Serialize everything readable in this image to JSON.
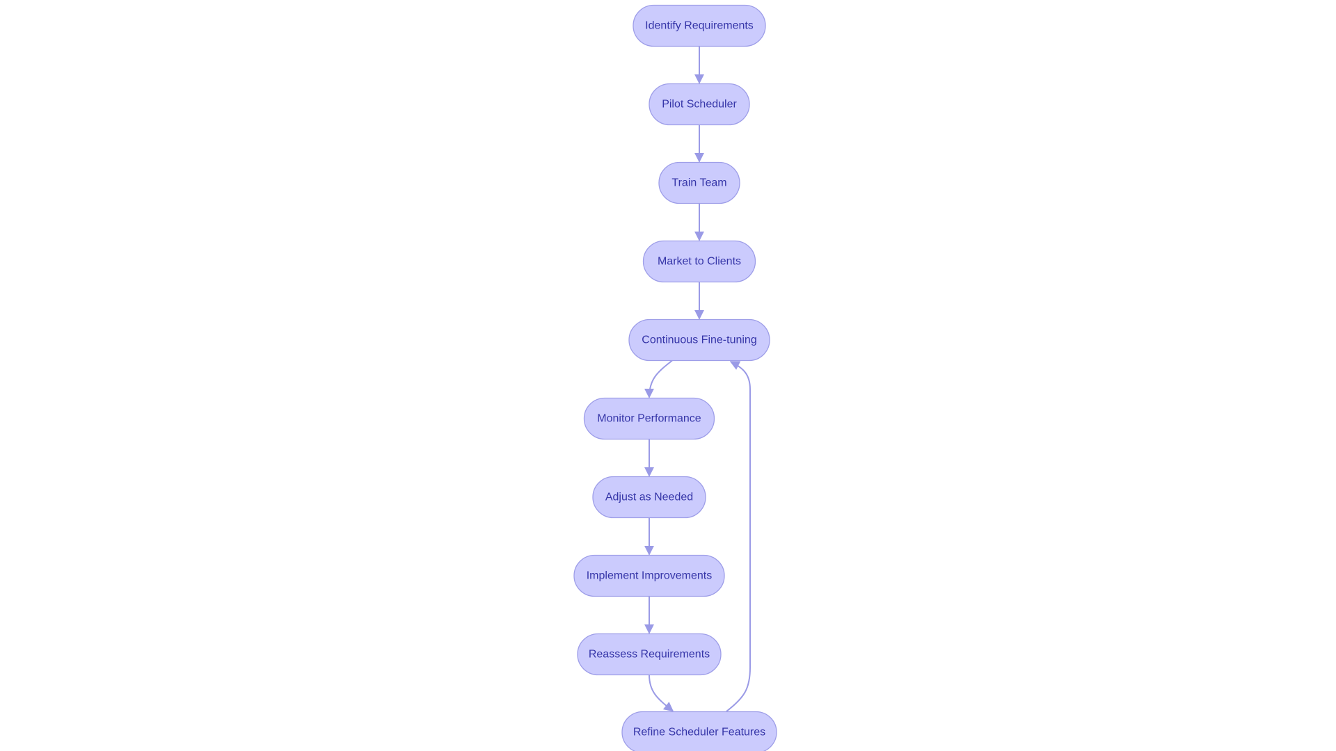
{
  "colors": {
    "node_fill": "#cbcbfd",
    "node_stroke": "#9e9ee8",
    "text": "#3535a8",
    "edge": "#9a9ae6"
  },
  "nodes": [
    {
      "id": "identify",
      "label": "Identify Requirements"
    },
    {
      "id": "pilot",
      "label": "Pilot Scheduler"
    },
    {
      "id": "train",
      "label": "Train Team"
    },
    {
      "id": "market",
      "label": "Market to Clients"
    },
    {
      "id": "finetune",
      "label": "Continuous Fine-tuning"
    },
    {
      "id": "monitor",
      "label": "Monitor Performance"
    },
    {
      "id": "adjust",
      "label": "Adjust as Needed"
    },
    {
      "id": "implement",
      "label": "Implement Improvements"
    },
    {
      "id": "reassess",
      "label": "Reassess Requirements"
    },
    {
      "id": "refine",
      "label": "Refine Scheduler Features"
    }
  ],
  "edges": [
    {
      "from": "identify",
      "to": "pilot"
    },
    {
      "from": "pilot",
      "to": "train"
    },
    {
      "from": "train",
      "to": "market"
    },
    {
      "from": "market",
      "to": "finetune"
    },
    {
      "from": "finetune",
      "to": "monitor"
    },
    {
      "from": "monitor",
      "to": "adjust"
    },
    {
      "from": "adjust",
      "to": "implement"
    },
    {
      "from": "implement",
      "to": "reassess"
    },
    {
      "from": "reassess",
      "to": "refine"
    },
    {
      "from": "refine",
      "to": "finetune"
    }
  ]
}
